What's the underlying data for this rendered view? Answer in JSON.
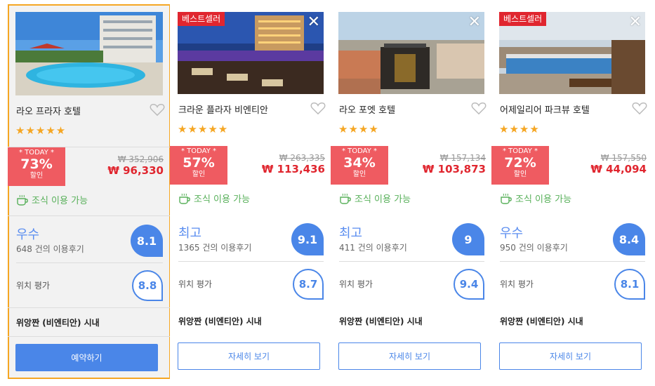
{
  "colors": {
    "accent": "#4a86e8",
    "highlight_border": "#f5a623",
    "sale_badge": "#ef5b61",
    "price": "#e0262f",
    "breakfast": "#58b05a",
    "bestseller": "#e0262f"
  },
  "hotels": [
    {
      "badge": "",
      "name": "라오 프라자 호텔",
      "stars": "★★★★★",
      "today": "* TODAY *",
      "discount": "73%",
      "discount_label": "할인",
      "old_price": "₩ 352,906",
      "price": "₩ 96,330",
      "breakfast": "조식 이용 가능",
      "rating_word": "우수",
      "review_count": "648 건의 이용후기",
      "score": "8.1",
      "location_label": "위치 평가",
      "location_score": "8.8",
      "area": "위앙짠 (비엔티안) 시내",
      "button": "예약하기",
      "close": ""
    },
    {
      "badge": "베스트셀러",
      "name": "크라운 플라자 비엔티안",
      "stars": "★★★★★",
      "today": "* TODAY *",
      "discount": "57%",
      "discount_label": "할인",
      "old_price": "₩ 263,335",
      "price": "₩ 113,436",
      "breakfast": "조식 이용 가능",
      "rating_word": "최고",
      "review_count": "1365 건의 이용후기",
      "score": "9.1",
      "location_label": "위치 평가",
      "location_score": "8.7",
      "area": "위앙짠 (비엔티안) 시내",
      "button": "자세히 보기",
      "close": "✕"
    },
    {
      "badge": "",
      "name": "라오 포엣 호텔",
      "stars": "★★★★",
      "today": "* TODAY *",
      "discount": "34%",
      "discount_label": "할인",
      "old_price": "₩ 157,134",
      "price": "₩ 103,873",
      "breakfast": "조식 이용 가능",
      "rating_word": "최고",
      "review_count": "411 건의 이용후기",
      "score": "9",
      "location_label": "위치 평가",
      "location_score": "9.4",
      "area": "위앙짠 (비엔티안) 시내",
      "button": "자세히 보기",
      "close": "✕"
    },
    {
      "badge": "베스트셀러",
      "name": "어제일리어 파크뷰 호텔",
      "stars": "★★★★",
      "today": "* TODAY *",
      "discount": "72%",
      "discount_label": "할인",
      "old_price": "₩ 157,550",
      "price": "₩ 44,094",
      "breakfast": "조식 이용 가능",
      "rating_word": "우수",
      "review_count": "950 건의 이용후기",
      "score": "8.4",
      "location_label": "위치 평가",
      "location_score": "8.1",
      "area": "위앙짠 (비엔티안) 시내",
      "button": "자세히 보기",
      "close": "✕"
    }
  ]
}
